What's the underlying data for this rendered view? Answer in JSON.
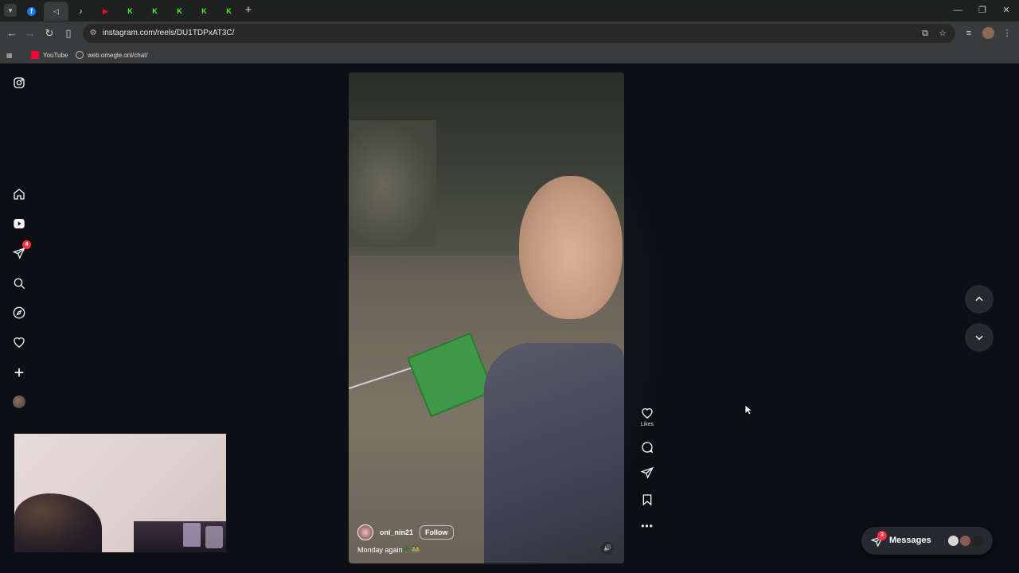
{
  "browser": {
    "tabs": [
      {
        "icon": "facebook-icon",
        "glyph": "f",
        "color": "#1877f2"
      },
      {
        "icon": "speaker-icon",
        "glyph": "◁",
        "color": "#cccccc",
        "active": true
      },
      {
        "icon": "tiktok-icon",
        "glyph": "♪",
        "color": "#ffffff"
      },
      {
        "icon": "youtube-icon",
        "glyph": "▶",
        "color": "#ff0033"
      },
      {
        "icon": "kick-icon",
        "glyph": "K",
        "color": "#53fc18"
      },
      {
        "icon": "kick-icon",
        "glyph": "K",
        "color": "#53fc18"
      },
      {
        "icon": "kick-icon",
        "glyph": "K",
        "color": "#53fc18"
      },
      {
        "icon": "kick-icon",
        "glyph": "K",
        "color": "#53fc18"
      },
      {
        "icon": "kick-icon",
        "glyph": "K",
        "color": "#53fc18"
      }
    ],
    "url": "instagram.com/reels/DU1TDPxAT3C/",
    "bookmarks": [
      {
        "label": "YouTube",
        "icon": "youtube-icon",
        "color": "#ff0033"
      },
      {
        "label": "web.omegle.onl/chat/",
        "icon": "globe-icon",
        "color": "#bbbbbb"
      }
    ]
  },
  "sidebar": {
    "notifications_badge": "4"
  },
  "reel": {
    "username": "oni_nin21",
    "follow_label": "Follow",
    "caption": "Monday again🪖🧑‍🤝‍🧑",
    "likes_label": "Likes"
  },
  "messages": {
    "label": "Messages",
    "badge": "3"
  },
  "colors": {
    "background": "#0c1014",
    "badge": "#ff3040",
    "chrome_tabstrip": "#1f2020",
    "chrome_toolbar": "#3a3b3c"
  }
}
